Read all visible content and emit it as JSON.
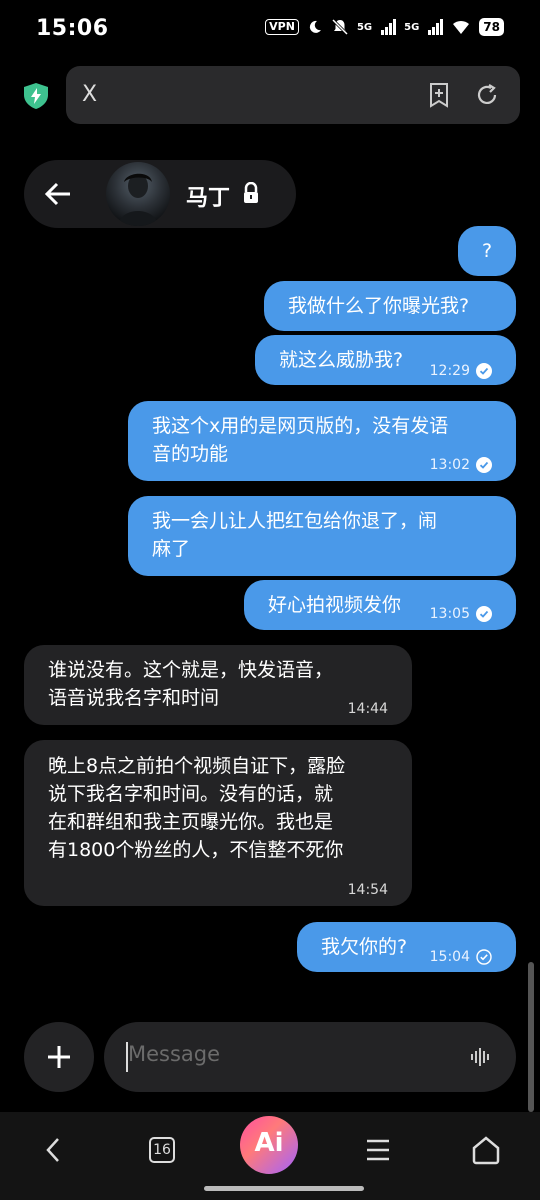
{
  "status_bar": {
    "time": "15:06",
    "vpn": "VPN",
    "signal1": "5G",
    "signal2": "5G",
    "battery": "78"
  },
  "browser": {
    "url": "X",
    "accent": "#3ec28f"
  },
  "chat": {
    "contact_name": "马丁",
    "messages": [
      {
        "dir": "out",
        "text": "?",
        "time": ""
      },
      {
        "dir": "out",
        "text": "我做什么了你曝光我?",
        "time": ""
      },
      {
        "dir": "out",
        "text": "就这么威胁我?",
        "time": "12:29"
      },
      {
        "dir": "out",
        "text": "我这个x用的是网页版的，没有发语\n音的功能",
        "time": "13:02"
      },
      {
        "dir": "out",
        "text": "我一会儿让人把红包给你退了，闹\n麻了",
        "time": ""
      },
      {
        "dir": "out",
        "text": "好心拍视频发你",
        "time": "13:05"
      },
      {
        "dir": "in",
        "text": "谁说没有。这个就是，快发语音，\n语音说我名字和时间",
        "time": "14:44"
      },
      {
        "dir": "in",
        "text": "晚上8点之前拍个视频自证下，露脸\n说下我名字和时间。没有的话，就\n在和群组和我主页曝光你。我也是\n有1800个粉丝的人，不信整不死你",
        "time": "14:54"
      },
      {
        "dir": "out",
        "text": "我欠你的?",
        "time": "15:04"
      }
    ],
    "composer_placeholder": "Message",
    "outgoing_color": "#4a99e9",
    "incoming_color": "#232325"
  },
  "navbar": {
    "tabs_count": "16",
    "ai_label": "Ai"
  }
}
